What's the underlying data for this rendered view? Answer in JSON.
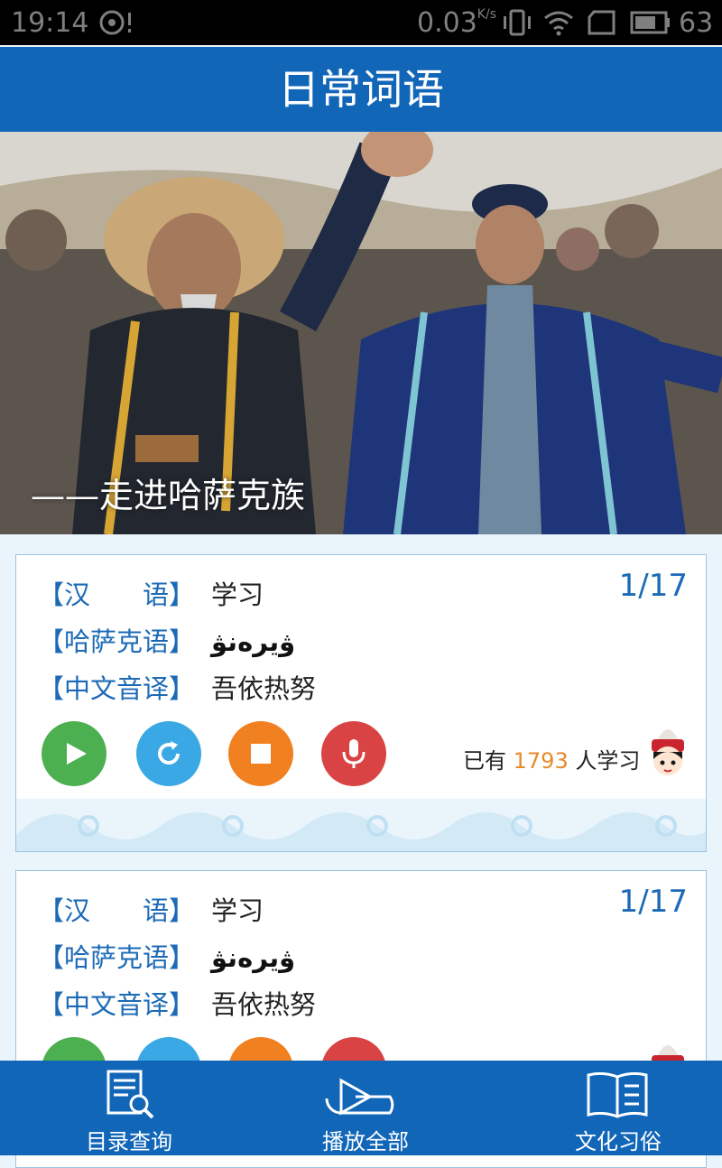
{
  "status_bar": {
    "time": "19:14",
    "network_speed": "0.03",
    "network_unit": "K/s",
    "battery": "63"
  },
  "header": {
    "title": "日常词语"
  },
  "banner": {
    "caption": "——走进哈萨克族"
  },
  "cards": [
    {
      "pager": "1/17",
      "rows": [
        {
          "label": "【汉　　语】",
          "value": "学习"
        },
        {
          "label": "【哈萨克语】",
          "value": "ۋيرەنۋ"
        },
        {
          "label": "【中文音译】",
          "value": "吾依热努"
        }
      ],
      "learners_prefix": "已有",
      "learners_count": "1793",
      "learners_suffix": "人学习"
    },
    {
      "pager": "1/17",
      "rows": [
        {
          "label": "【汉　　语】",
          "value": "学习"
        },
        {
          "label": "【哈萨克语】",
          "value": "ۋيرەنۋ"
        },
        {
          "label": "【中文音译】",
          "value": "吾依热努"
        }
      ]
    }
  ],
  "buttons": {
    "play_color": "#4cb050",
    "repeat_color": "#3aa8e4",
    "stop_color": "#f08020",
    "record_color": "#d94343"
  },
  "bottom_nav": [
    {
      "label": "目录查询",
      "icon": "document-search-icon"
    },
    {
      "label": "播放全部",
      "icon": "play-all-icon"
    },
    {
      "label": "文化习俗",
      "icon": "open-book-icon"
    }
  ]
}
